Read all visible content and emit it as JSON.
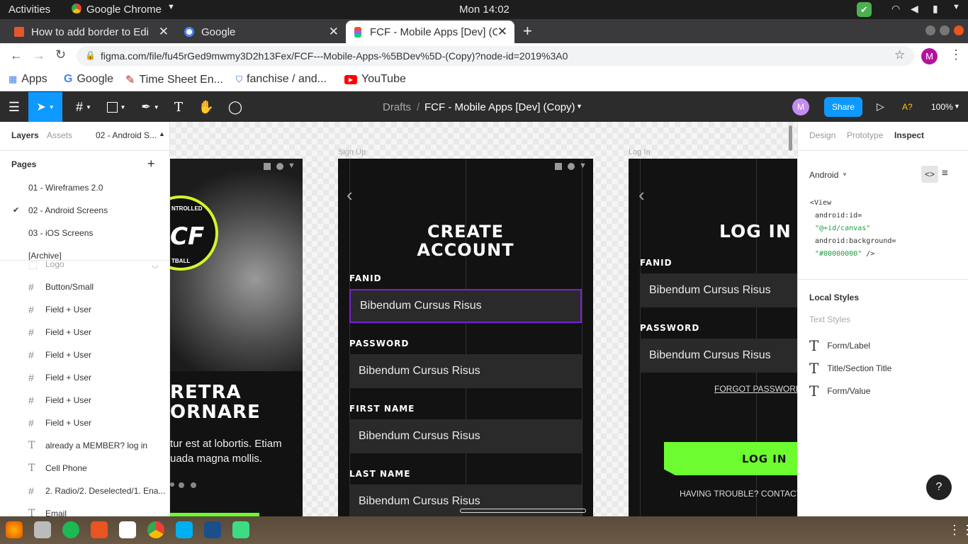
{
  "system": {
    "activities": "Activities",
    "app_name": "Google Chrome",
    "clock": "Mon 14:02"
  },
  "tabs": [
    {
      "title": "How to add border to Edi",
      "active": false
    },
    {
      "title": "Google",
      "active": false
    },
    {
      "title": "FCF - Mobile Apps [Dev] (C",
      "active": true
    }
  ],
  "address": {
    "url": "figma.com/file/fu45rGed9mwmy3D2h13Fex/FCF---Mobile-Apps-%5BDev%5D-(Copy)?node-id=2019%3A0",
    "profile_initial": "M"
  },
  "bookmarks": [
    "Apps",
    "Google",
    "Time Sheet En...",
    "fanchise / and...",
    "YouTube"
  ],
  "figma_toolbar": {
    "breadcrumb_root": "Drafts",
    "separator": "/",
    "file_name": "FCF - Mobile Apps [Dev] (Copy)",
    "avatar_initial": "M",
    "share_label": "Share",
    "a11y_label": "A?",
    "zoom": "100%"
  },
  "left_panel": {
    "tab_layers": "Layers",
    "tab_assets": "Assets",
    "page_selector": "02 - Android S...",
    "pages_heading": "Pages",
    "pages": [
      {
        "name": "01 - Wireframes 2.0",
        "selected": false
      },
      {
        "name": "02 - Android Screens",
        "selected": true
      },
      {
        "name": "03 - iOS Screens",
        "selected": false
      },
      {
        "name": "[Archive]",
        "selected": false
      }
    ],
    "layers": [
      {
        "name": "Logo",
        "icon": "#"
      },
      {
        "name": "Button/Small",
        "icon": "#"
      },
      {
        "name": "Field + User",
        "icon": "#"
      },
      {
        "name": "Field + User",
        "icon": "#"
      },
      {
        "name": "Field + User",
        "icon": "#"
      },
      {
        "name": "Field + User",
        "icon": "#"
      },
      {
        "name": "Field + User",
        "icon": "#"
      },
      {
        "name": "Field + User",
        "icon": "#"
      },
      {
        "name": "already a MEMBER? log in",
        "icon": "T"
      },
      {
        "name": "Cell Phone",
        "icon": "T"
      },
      {
        "name": "2. Radio/2. Deselected/1. Ena...",
        "icon": "#"
      },
      {
        "name": "Email",
        "icon": "T"
      }
    ]
  },
  "canvas": {
    "frame_left": {
      "heading_line1": "RETRA",
      "heading_line2": "ORNARE",
      "body_line1": "tur est at lobortis. Etiam",
      "body_line2": "uada magna mollis.",
      "logo_text": "CF",
      "logo_ring_top": "NTROLLED",
      "logo_ring_bottom": "TBALL"
    },
    "frame_signup": {
      "label": "Sign Up",
      "heading_line1": "CREATE",
      "heading_line2": "ACCOUNT",
      "fields": [
        {
          "label": "FANID",
          "value": "Bibendum Cursus Risus",
          "focused": true
        },
        {
          "label": "PASSWORD",
          "value": "Bibendum Cursus Risus",
          "focused": false
        },
        {
          "label": "FIRST NAME",
          "value": "Bibendum Cursus Risus",
          "focused": false
        },
        {
          "label": "LAST NAME",
          "value": "Bibendum Cursus Risus",
          "focused": false
        }
      ]
    },
    "frame_login": {
      "label": "Log In",
      "heading": "LOG IN",
      "fields": [
        {
          "label": "FANID",
          "value": "Bibendum Cursus Risus"
        },
        {
          "label": "PASSWORD",
          "value": "Bibendum Cursus Risus"
        }
      ],
      "forgot": "FORGOT PASSWORD?",
      "button": "LOG IN",
      "trouble": "HAVING TROUBLE? CONTACT S"
    },
    "accent_green": "#6dfc2f",
    "focus_purple": "#7b1fd6"
  },
  "right_panel": {
    "tab_design": "Design",
    "tab_prototype": "Prototype",
    "tab_inspect": "Inspect",
    "platform": "Android",
    "code": {
      "line1": "<View",
      "line2": "android:id=",
      "line3": "\"@+id/canvas\"",
      "line4": "android:background=",
      "line5": "\"#00000000\"",
      "line5_end": " />"
    },
    "local_styles_heading": "Local Styles",
    "text_styles_heading": "Text Styles",
    "styles": [
      "Form/Label",
      "Title/Section Title",
      "Form/Value"
    ],
    "help": "?"
  }
}
